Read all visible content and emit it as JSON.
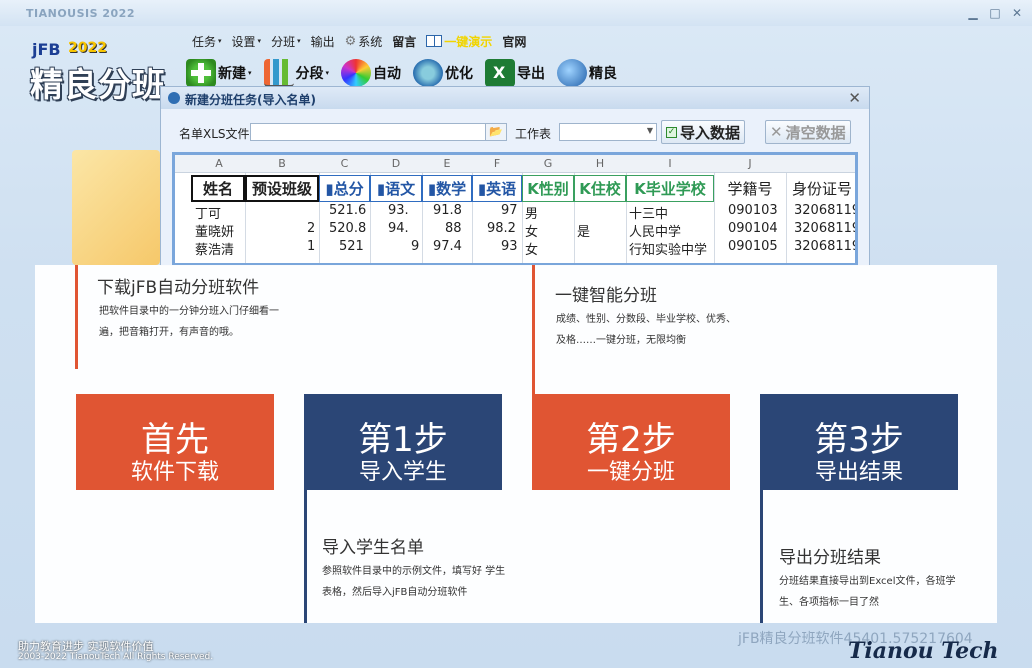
{
  "app": {
    "title": "TIANOUSIS 2022",
    "win_min": "▁",
    "win_max": "□",
    "win_close": "✕"
  },
  "logo": {
    "jfb": "jFB",
    "year": "2022",
    "name": "精良分班"
  },
  "menu": [
    {
      "label": "任务",
      "caret": "▾"
    },
    {
      "label": "设置",
      "caret": "▾"
    },
    {
      "label": "分班",
      "caret": "▾"
    },
    {
      "label": "输出"
    },
    {
      "label": "系统",
      "icon": "gear-icon"
    },
    {
      "label": "留言"
    },
    {
      "label": "一键演示",
      "icon": "book-icon"
    },
    {
      "label": "官网"
    }
  ],
  "toolbar": [
    {
      "label": "新建",
      "icon": "add-icon"
    },
    {
      "label": "分段",
      "icon": "bar-chart-icon"
    },
    {
      "label": "自动",
      "icon": "color-wheel-icon"
    },
    {
      "label": "优化",
      "icon": "optimize-icon"
    },
    {
      "label": "导出",
      "icon": "excel-icon"
    },
    {
      "label": "精良",
      "icon": "globe-icon"
    }
  ],
  "dialog": {
    "title": "新建分班任务(导入名单)",
    "close": "✕",
    "file_label": "名单XLS文件",
    "file_value": "",
    "sheet_label": "工作表",
    "sheet_value": "",
    "import_button": "导入数据",
    "clear_button": "清空数据"
  },
  "sheet": {
    "columns": [
      "A",
      "B",
      "C",
      "D",
      "E",
      "F",
      "G",
      "H",
      "I",
      "J"
    ],
    "headers": [
      "姓名",
      "预设班级",
      "▮总分",
      "▮语文",
      "▮数学",
      "▮英语",
      "K性别",
      "K住校",
      "K毕业学校",
      "学籍号",
      "身份证号"
    ],
    "rows": [
      [
        "丁可",
        "",
        "521.6",
        "93.",
        "91.8",
        "97",
        "男",
        "",
        "十三中",
        "090103",
        "32068119"
      ],
      [
        "董晓妍",
        "2",
        "520.8",
        "94.",
        "88",
        "98.2",
        "女",
        "是",
        "人民中学",
        "090104",
        "32068119"
      ],
      [
        "蔡浩清",
        "1",
        "521",
        "9",
        "97.4",
        "93",
        "女",
        "",
        "行知实验中学",
        "090105",
        "32068119"
      ]
    ]
  },
  "overlay": {
    "card1": {
      "title": "下载jFB自动分班软件",
      "text1": "把软件目录中的一分钟分班入门仔细看一",
      "text2": "遍，把音箱打开，有声音的哦。"
    },
    "card3": {
      "title": "一键智能分班",
      "text1": "成绩、性别、分数段、毕业学校、优秀、",
      "text2": "及格……一键分班，无限均衡"
    },
    "card2": {
      "title": "导入学生名单",
      "text1": "参照软件目录中的示例文件，填写好 学生",
      "text2": "表格，然后导入jFB自动分班软件"
    },
    "card4": {
      "title": "导出分班结果",
      "text1": "分班结果直接导出到Excel文件，各班学",
      "text2": "生、各项指标一目了然"
    },
    "steps": [
      {
        "big": "首先",
        "small": "软件下载",
        "color": "#e05533"
      },
      {
        "big": "第1步",
        "small": "导入学生",
        "color": "#2b4676"
      },
      {
        "big": "第2步",
        "small": "一键分班",
        "color": "#e05533"
      },
      {
        "big": "第3步",
        "small": "导出结果",
        "color": "#2b4676"
      }
    ]
  },
  "footer": {
    "slogan": "助力教育进步  实现软件价值",
    "copyright": "2003-2022 TianouTech All Rights Reserved.",
    "version": "jFB精良分班软件45401.575217604",
    "brand": "Tianou Tech"
  }
}
